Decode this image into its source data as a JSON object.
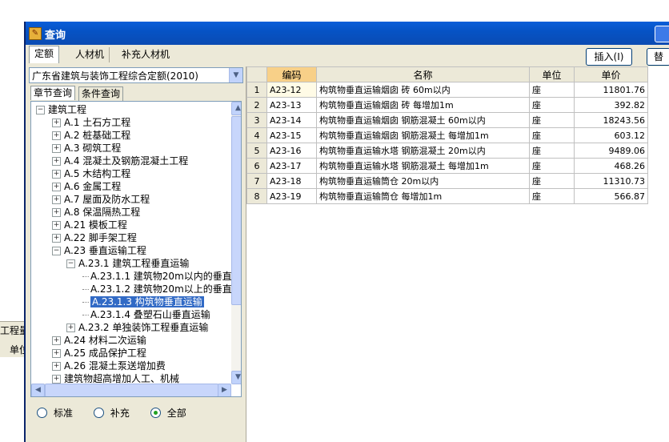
{
  "window": {
    "title": "查询"
  },
  "tabs": [
    {
      "label": "定额",
      "active": true
    },
    {
      "label": "人材机"
    },
    {
      "label": "补充人材机"
    }
  ],
  "toolbar": {
    "insert_label": "插入(I)",
    "replace_label": "替"
  },
  "quota_combo": {
    "value": "广东省建筑与装饰工程综合定额(2010)"
  },
  "subtabs": [
    {
      "label": "章节查询",
      "active": true
    },
    {
      "label": "条件查询"
    }
  ],
  "tree": [
    {
      "label": "建筑工程",
      "level": 0,
      "exp": "minus"
    },
    {
      "label": "A.1 土石方工程",
      "level": 1,
      "exp": "plus"
    },
    {
      "label": "A.2 桩基础工程",
      "level": 1,
      "exp": "plus"
    },
    {
      "label": "A.3 砌筑工程",
      "level": 1,
      "exp": "plus"
    },
    {
      "label": "A.4 混凝土及钢筋混凝土工程",
      "level": 1,
      "exp": "plus"
    },
    {
      "label": "A.5 木结构工程",
      "level": 1,
      "exp": "plus"
    },
    {
      "label": "A.6 金属工程",
      "level": 1,
      "exp": "plus"
    },
    {
      "label": "A.7 屋面及防水工程",
      "level": 1,
      "exp": "plus"
    },
    {
      "label": "A.8 保温隔热工程",
      "level": 1,
      "exp": "plus"
    },
    {
      "label": "A.21 模板工程",
      "level": 1,
      "exp": "plus"
    },
    {
      "label": "A.22 脚手架工程",
      "level": 1,
      "exp": "plus"
    },
    {
      "label": "A.23 垂直运输工程",
      "level": 1,
      "exp": "minus"
    },
    {
      "label": "A.23.1 建筑工程垂直运输",
      "level": 2,
      "exp": "minus"
    },
    {
      "label": "A.23.1.1 建筑物20m以内的垂直",
      "level": 3,
      "exp": "leaf"
    },
    {
      "label": "A.23.1.2 建筑物20m以上的垂直",
      "level": 3,
      "exp": "leaf"
    },
    {
      "label": "A.23.1.3 构筑物垂直运输",
      "level": 3,
      "exp": "leaf",
      "selected": true
    },
    {
      "label": "A.23.1.4 叠塑石山垂直运输",
      "level": 3,
      "exp": "leaf"
    },
    {
      "label": "A.23.2 单独装饰工程垂直运输",
      "level": 2,
      "exp": "plus"
    },
    {
      "label": "A.24 材料二次运输",
      "level": 1,
      "exp": "plus"
    },
    {
      "label": "A.25 成品保护工程",
      "level": 1,
      "exp": "plus"
    },
    {
      "label": "A.26 混凝土泵送增加费",
      "level": 1,
      "exp": "plus"
    },
    {
      "label": "建筑物超高增加人工、机械",
      "level": 1,
      "exp": "plus"
    }
  ],
  "radios": [
    {
      "label": "标准"
    },
    {
      "label": "补充"
    },
    {
      "label": "全部",
      "checked": true
    }
  ],
  "grid": {
    "headers": [
      "编码",
      "名称",
      "单位",
      "单价"
    ],
    "rows": [
      {
        "n": "1",
        "code": "A23-12",
        "name": "构筑物垂直运输烟囱 砖 60m以内",
        "unit": "座",
        "price": "11801.76"
      },
      {
        "n": "2",
        "code": "A23-13",
        "name": "构筑物垂直运输烟囱 砖 每增加1m",
        "unit": "座",
        "price": "392.82"
      },
      {
        "n": "3",
        "code": "A23-14",
        "name": "构筑物垂直运输烟囱 钢筋混凝土 60m以内",
        "unit": "座",
        "price": "18243.56"
      },
      {
        "n": "4",
        "code": "A23-15",
        "name": "构筑物垂直运输烟囱 钢筋混凝土 每增加1m",
        "unit": "座",
        "price": "603.12"
      },
      {
        "n": "5",
        "code": "A23-16",
        "name": "构筑物垂直运输水塔 钢筋混凝土 20m以内",
        "unit": "座",
        "price": "9489.06"
      },
      {
        "n": "6",
        "code": "A23-17",
        "name": "构筑物垂直运输水塔 钢筋混凝土 每增加1m",
        "unit": "座",
        "price": "468.26"
      },
      {
        "n": "7",
        "code": "A23-18",
        "name": "构筑物垂直运输筒仓 20m以内",
        "unit": "座",
        "price": "11310.73"
      },
      {
        "n": "8",
        "code": "A23-19",
        "name": "构筑物垂直运输筒仓 每增加1m",
        "unit": "座",
        "price": "566.87"
      }
    ]
  },
  "background": {
    "label1": "工程量",
    "label2": "单位"
  }
}
